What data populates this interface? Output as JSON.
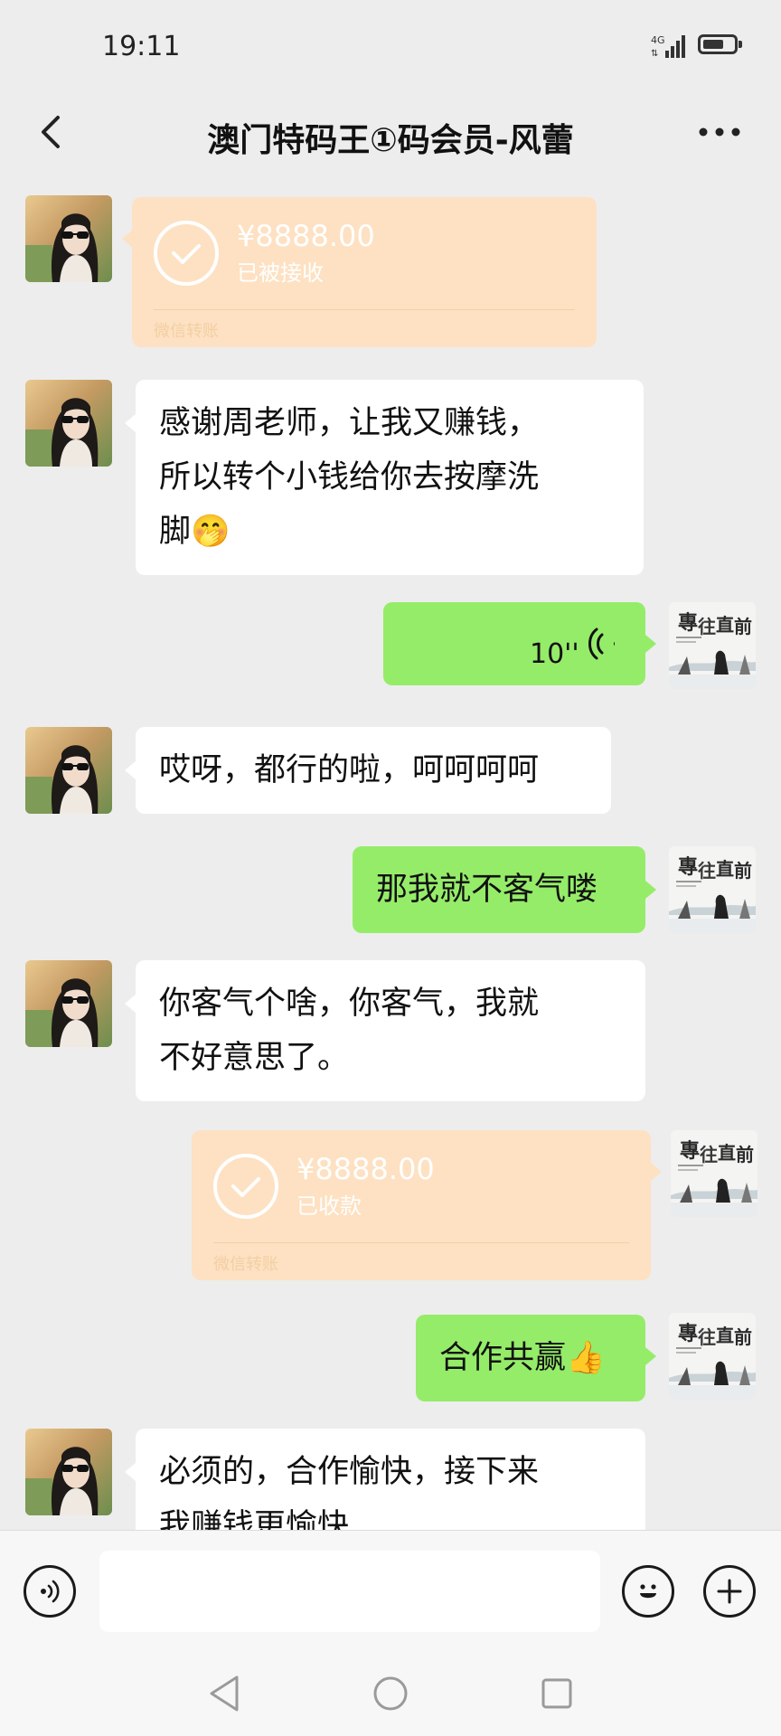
{
  "status_bar": {
    "time": "19:11",
    "network": "4G"
  },
  "header": {
    "title": "澳门特码王①码会员-风蕾"
  },
  "messages": [
    {
      "type": "transfer",
      "side": "in",
      "amount": "¥8888.00",
      "status": "已被接收",
      "footer": "微信转账"
    },
    {
      "type": "text",
      "side": "in",
      "lines": [
        "感谢周老师，让我又赚钱，",
        "所以转个小钱给你去按摩洗",
        "脚🤭"
      ]
    },
    {
      "type": "voice",
      "side": "out",
      "duration": "10''"
    },
    {
      "type": "text",
      "side": "in",
      "lines": [
        "哎呀，都行的啦，呵呵呵呵"
      ]
    },
    {
      "type": "text",
      "side": "out",
      "lines": [
        "那我就不客气喽"
      ]
    },
    {
      "type": "text",
      "side": "in",
      "lines": [
        "你客气个啥，你客气，我就",
        "不好意思了。"
      ]
    },
    {
      "type": "transfer",
      "side": "out",
      "amount": "¥8888.00",
      "status": "已收款",
      "footer": "微信转账"
    },
    {
      "type": "text",
      "side": "out",
      "lines": [
        "合作共赢👍"
      ]
    },
    {
      "type": "text",
      "side": "in",
      "lines": [
        "必须的，合作愉快，接下来",
        "我赚钱更愉快"
      ]
    }
  ],
  "input": {
    "placeholder": ""
  },
  "colors": {
    "background": "#ededed",
    "bubble_out": "#95ec69",
    "bubble_in": "#ffffff",
    "transfer": "#fde1c2"
  }
}
